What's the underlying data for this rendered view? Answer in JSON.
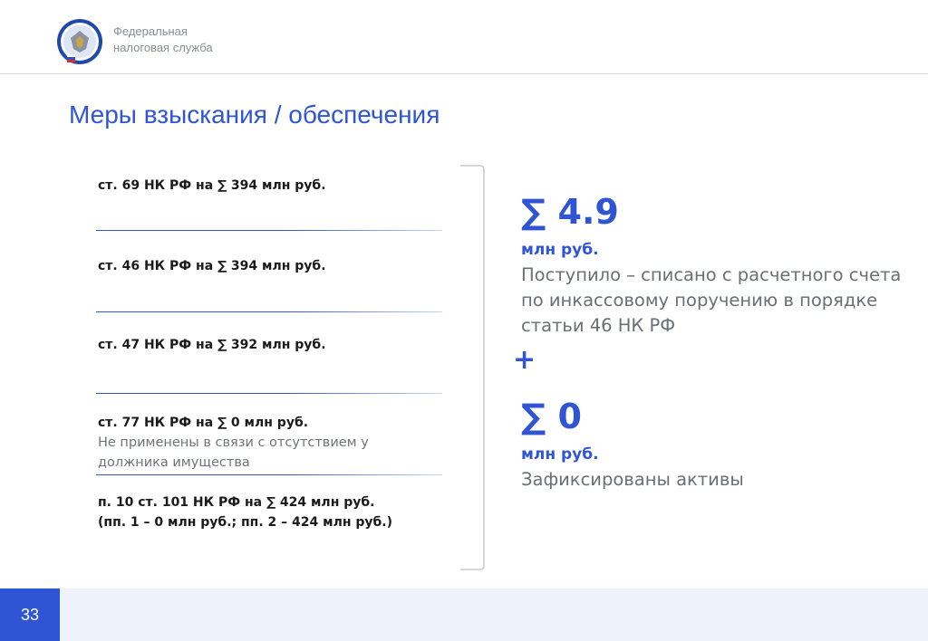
{
  "header": {
    "org_name": "Федеральная\nналоговая служба"
  },
  "slide": {
    "title": "Меры взыскания / обеспечения"
  },
  "measures": [
    {
      "text": "ст. 69 НК РФ на ∑ 394 млн руб."
    },
    {
      "text": "ст. 46 НК РФ на ∑ 394 млн руб."
    },
    {
      "text": "ст. 47 НК РФ на ∑ 392 млн руб."
    },
    {
      "text": "ст. 77 НК РФ на ∑ 0 млн руб.",
      "note": "Не применены в связи с отсутствием у должника имущества"
    },
    {
      "text": "п. 10 ст. 101 НК РФ на ∑ 424 млн руб.",
      "text2": "(пп. 1 – 0 млн руб.; пп. 2 – 424 млн руб.)"
    }
  ],
  "summary": {
    "first": {
      "amount": "∑ 4.9",
      "unit": "млн руб.",
      "description": "Поступило – списано с расчетного счета по инкассовому поручению в порядке статьи 46 НК РФ"
    },
    "plus": "+",
    "second": {
      "amount": "∑ 0",
      "unit": "млн руб.",
      "description": "Зафиксированы активы"
    }
  },
  "footer": {
    "page_number": "33"
  },
  "colors": {
    "accent": "#2f55d4",
    "muted_text": "#6b6e73"
  }
}
